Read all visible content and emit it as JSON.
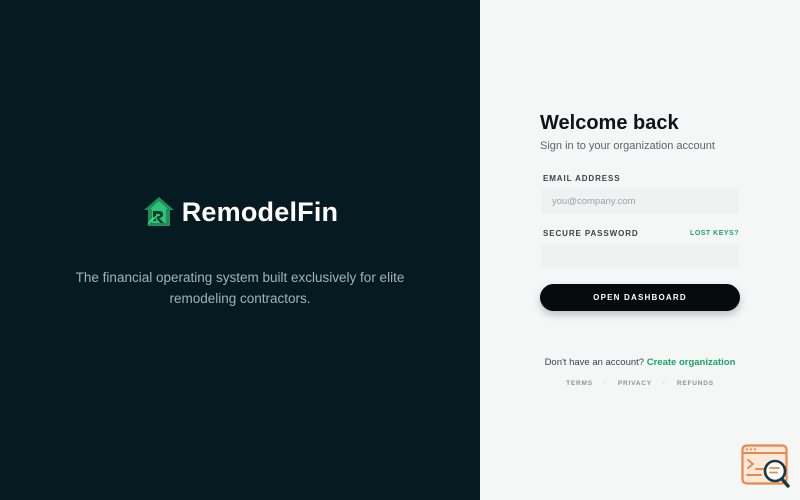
{
  "brand": {
    "name": "RemodelFin",
    "tagline": "The financial operating system built exclusively for elite remodeling contractors.",
    "logo_icon": "house-leaf-logo-icon",
    "colors": {
      "panel": "#061a22",
      "accent": "#18a566"
    }
  },
  "login": {
    "title": "Welcome back",
    "subtitle": "Sign in to your organization account",
    "email_label": "EMAIL ADDRESS",
    "email_placeholder": "you@company.com",
    "email_value": "",
    "password_label": "SECURE PASSWORD",
    "password_value": "",
    "lost_keys_label": "LOST KEYS?",
    "submit_label": "OPEN DASHBOARD",
    "signup_prompt": "Don't have an account?",
    "signup_link": "Create organization"
  },
  "footer": {
    "terms": "TERMS",
    "separator_1": "·",
    "privacy": "PRIVACY",
    "separator_2": "·",
    "refunds": "REFUNDS"
  },
  "widget": {
    "icon": "code-search-icon",
    "color": "#e8884a"
  }
}
